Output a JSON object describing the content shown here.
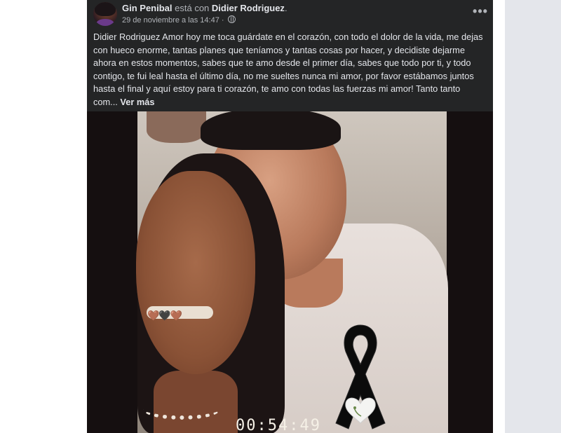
{
  "post": {
    "author": "Gin Penibal",
    "connector": "está con",
    "tagged_person": "Didier Rodriguez",
    "date": "29 de noviembre a las 14:47",
    "separator": "·",
    "body": "Didier Rodriguez   Amor hoy me toca guárdate en el corazón, con todo el dolor de la vida, me dejas con hueco enorme, tantas planes que teníamos y tantas cosas por hacer, y decidiste dejarme ahora en estos momentos, sabes que te amo desde el primer día, sabes que todo por ti, y todo contigo, te fui leal hasta el último día, no me sueltes  nunca mi amor, por favor estábamos juntos hasta el final y aquí estoy para ti corazón, te amo con todas las fuerzas mi amor! Tanto tanto com...",
    "see_more_label": "Ver más",
    "more_options_label": "•••"
  },
  "photo": {
    "hearts": "🤎🖤🤎",
    "overlay_time": "00:54:49"
  },
  "icons": {
    "audience": "globe-icon",
    "ribbon": "black-ribbon-icon"
  },
  "colors": {
    "post_background": "#242526",
    "page_background": "#ffffff",
    "side_panel": "#e4e6eb",
    "primary_text": "#e4e6eb",
    "secondary_text": "#b0b3b8"
  }
}
